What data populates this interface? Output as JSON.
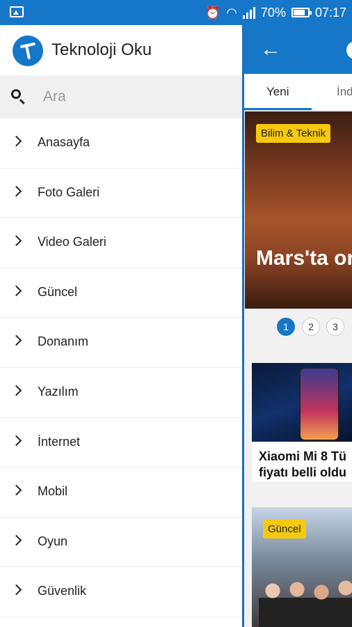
{
  "status_bar": {
    "battery_percent": "70%",
    "time": "07:17",
    "icons": [
      "image-icon",
      "alarm-icon",
      "wifi-icon",
      "signal-icon",
      "battery-icon"
    ]
  },
  "drawer": {
    "app_name": "Teknoloji Oku",
    "search_placeholder": "Ara",
    "menu_items": [
      {
        "label": "Anasayfa"
      },
      {
        "label": "Foto Galeri"
      },
      {
        "label": "Video Galeri"
      },
      {
        "label": "Güncel"
      },
      {
        "label": "Donanım"
      },
      {
        "label": "Yazılım"
      },
      {
        "label": "İnternet"
      },
      {
        "label": "Mobil"
      },
      {
        "label": "Oyun"
      },
      {
        "label": "Güvenlik"
      }
    ]
  },
  "background_app": {
    "tabs": [
      {
        "label": "Yeni"
      },
      {
        "label": "İnd"
      }
    ],
    "hero": {
      "badge": "Bilim & Teknik",
      "title": "Mars'ta or keşfedildi"
    },
    "pager": [
      "1",
      "2",
      "3"
    ],
    "card1": {
      "title_line1": "Xiaomi Mi 8 Tü",
      "title_line2": "fiyatı belli oldu"
    },
    "card2": {
      "badge": "Güncel"
    }
  },
  "colors": {
    "accent": "#1677c9",
    "badge": "#f6c90e"
  }
}
